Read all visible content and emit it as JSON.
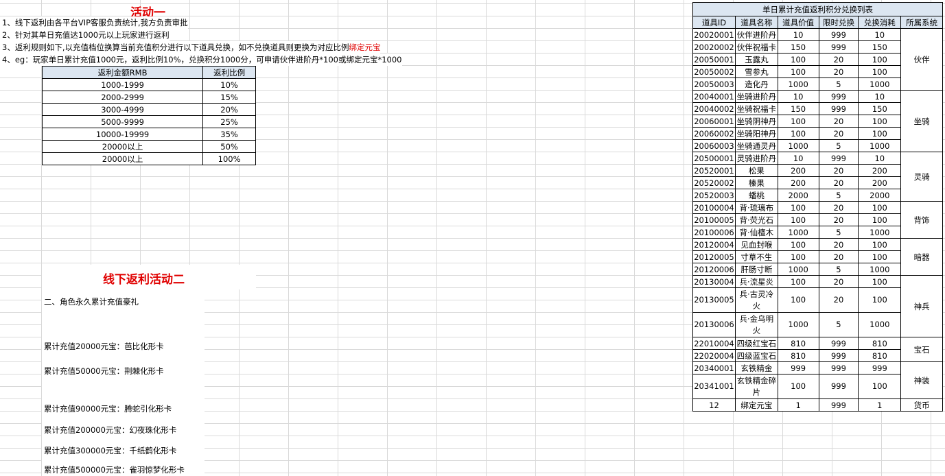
{
  "activity1": {
    "title": "活动一",
    "lines": [
      "1、线下返利由各平台VIP客服负责统计,我方负责审批",
      "2、针对其单日充值达1000元以上玩家进行返利",
      "3、返利规则如下,以充值档位换算当前充值积分进行以下道具兑换，如不兑换道具则更换为对应比例",
      "4、eg：玩家单日累计充值1000元，返利比例10%，兑换积分1000分，可申请伙伴进阶丹*100或绑定元宝*1000"
    ],
    "line3_red": "绑定元宝"
  },
  "rebate_table": {
    "headers": [
      "返利金额RMB",
      "返利比例"
    ],
    "rows": [
      [
        "1000-1999",
        "10%"
      ],
      [
        "2000-2999",
        "15%"
      ],
      [
        "3000-4999",
        "20%"
      ],
      [
        "5000-9999",
        "25%"
      ],
      [
        "10000-19999",
        "35%"
      ],
      [
        "20000以上",
        "50%"
      ],
      [
        "20000以上",
        "100%"
      ]
    ]
  },
  "activity2": {
    "title": "线下返利活动二",
    "subtitle": "二、角色永久累计充值豪礼",
    "rewards": [
      "累计充值20000元宝：芭比化形卡",
      "累计充值50000元宝：荆棘化形卡",
      "累计充值90000元宝：腾蛇引化形卡",
      "累计充值200000元宝：幻夜珠化形卡",
      "累计充值300000元宝：千纸鹤化形卡",
      "累计充值500000元宝：雀羽惊梦化形卡"
    ]
  },
  "item_table": {
    "caption": "单日累计充值返利积分兑换列表",
    "headers": [
      "道具ID",
      "道具名称",
      "道具价值",
      "限时兑换",
      "兑换消耗",
      "所属系统"
    ],
    "groups": [
      {
        "system": "伙伴",
        "rows": [
          [
            "20020001",
            "伙伴进阶丹",
            "10",
            "999",
            "10"
          ],
          [
            "20020002",
            "伙伴祝福卡",
            "150",
            "999",
            "150"
          ],
          [
            "20050001",
            "玉露丸",
            "100",
            "20",
            "100"
          ],
          [
            "20050002",
            "雪参丸",
            "100",
            "20",
            "100"
          ],
          [
            "20050003",
            "造化丹",
            "1000",
            "5",
            "1000"
          ]
        ]
      },
      {
        "system": "坐骑",
        "rows": [
          [
            "20040001",
            "坐骑进阶丹",
            "10",
            "999",
            "10"
          ],
          [
            "20040002",
            "坐骑祝福卡",
            "150",
            "999",
            "150"
          ],
          [
            "20060001",
            "坐骑阴神丹",
            "100",
            "20",
            "100"
          ],
          [
            "20060002",
            "坐骑阳神丹",
            "100",
            "20",
            "100"
          ],
          [
            "20060003",
            "坐骑通灵丹",
            "1000",
            "5",
            "1000"
          ]
        ]
      },
      {
        "system": "灵骑",
        "rows": [
          [
            "20500001",
            "灵骑进阶丹",
            "10",
            "999",
            "10"
          ],
          [
            "20520001",
            "松果",
            "200",
            "20",
            "200"
          ],
          [
            "20520002",
            "榛果",
            "200",
            "20",
            "200"
          ],
          [
            "20520003",
            "蟠桃",
            "2000",
            "5",
            "2000"
          ]
        ]
      },
      {
        "system": "背饰",
        "rows": [
          [
            "20100004",
            "背·琉璃布",
            "100",
            "20",
            "100"
          ],
          [
            "20100005",
            "背·荧光石",
            "100",
            "20",
            "100"
          ],
          [
            "20100006",
            "背·仙檀木",
            "1000",
            "5",
            "1000"
          ]
        ]
      },
      {
        "system": "暗器",
        "rows": [
          [
            "20120004",
            "见血封喉",
            "100",
            "20",
            "100"
          ],
          [
            "20120005",
            "寸草不生",
            "100",
            "20",
            "100"
          ],
          [
            "20120006",
            "肝肠寸断",
            "1000",
            "5",
            "1000"
          ]
        ]
      },
      {
        "system": "神兵",
        "rows": [
          [
            "20130004",
            "兵·流星炎",
            "100",
            "20",
            "100"
          ],
          [
            "20130005",
            "兵·古灵冷火",
            "100",
            "20",
            "100"
          ],
          [
            "20130006",
            "兵·金乌明火",
            "1000",
            "5",
            "1000"
          ]
        ]
      },
      {
        "system": "宝石",
        "rows": [
          [
            "22010004",
            "四级红宝石",
            "810",
            "999",
            "810"
          ],
          [
            "22020004",
            "四级蓝宝石",
            "810",
            "999",
            "810"
          ]
        ]
      },
      {
        "system": "神装",
        "rows": [
          [
            "20340001",
            "玄铁精金",
            "999",
            "999",
            "999"
          ],
          [
            "20341001",
            "玄铁精金碎片",
            "100",
            "999",
            "100"
          ]
        ]
      },
      {
        "system": "货币",
        "rows": [
          [
            "12",
            "绑定元宝",
            "1",
            "999",
            "1"
          ]
        ]
      }
    ]
  }
}
